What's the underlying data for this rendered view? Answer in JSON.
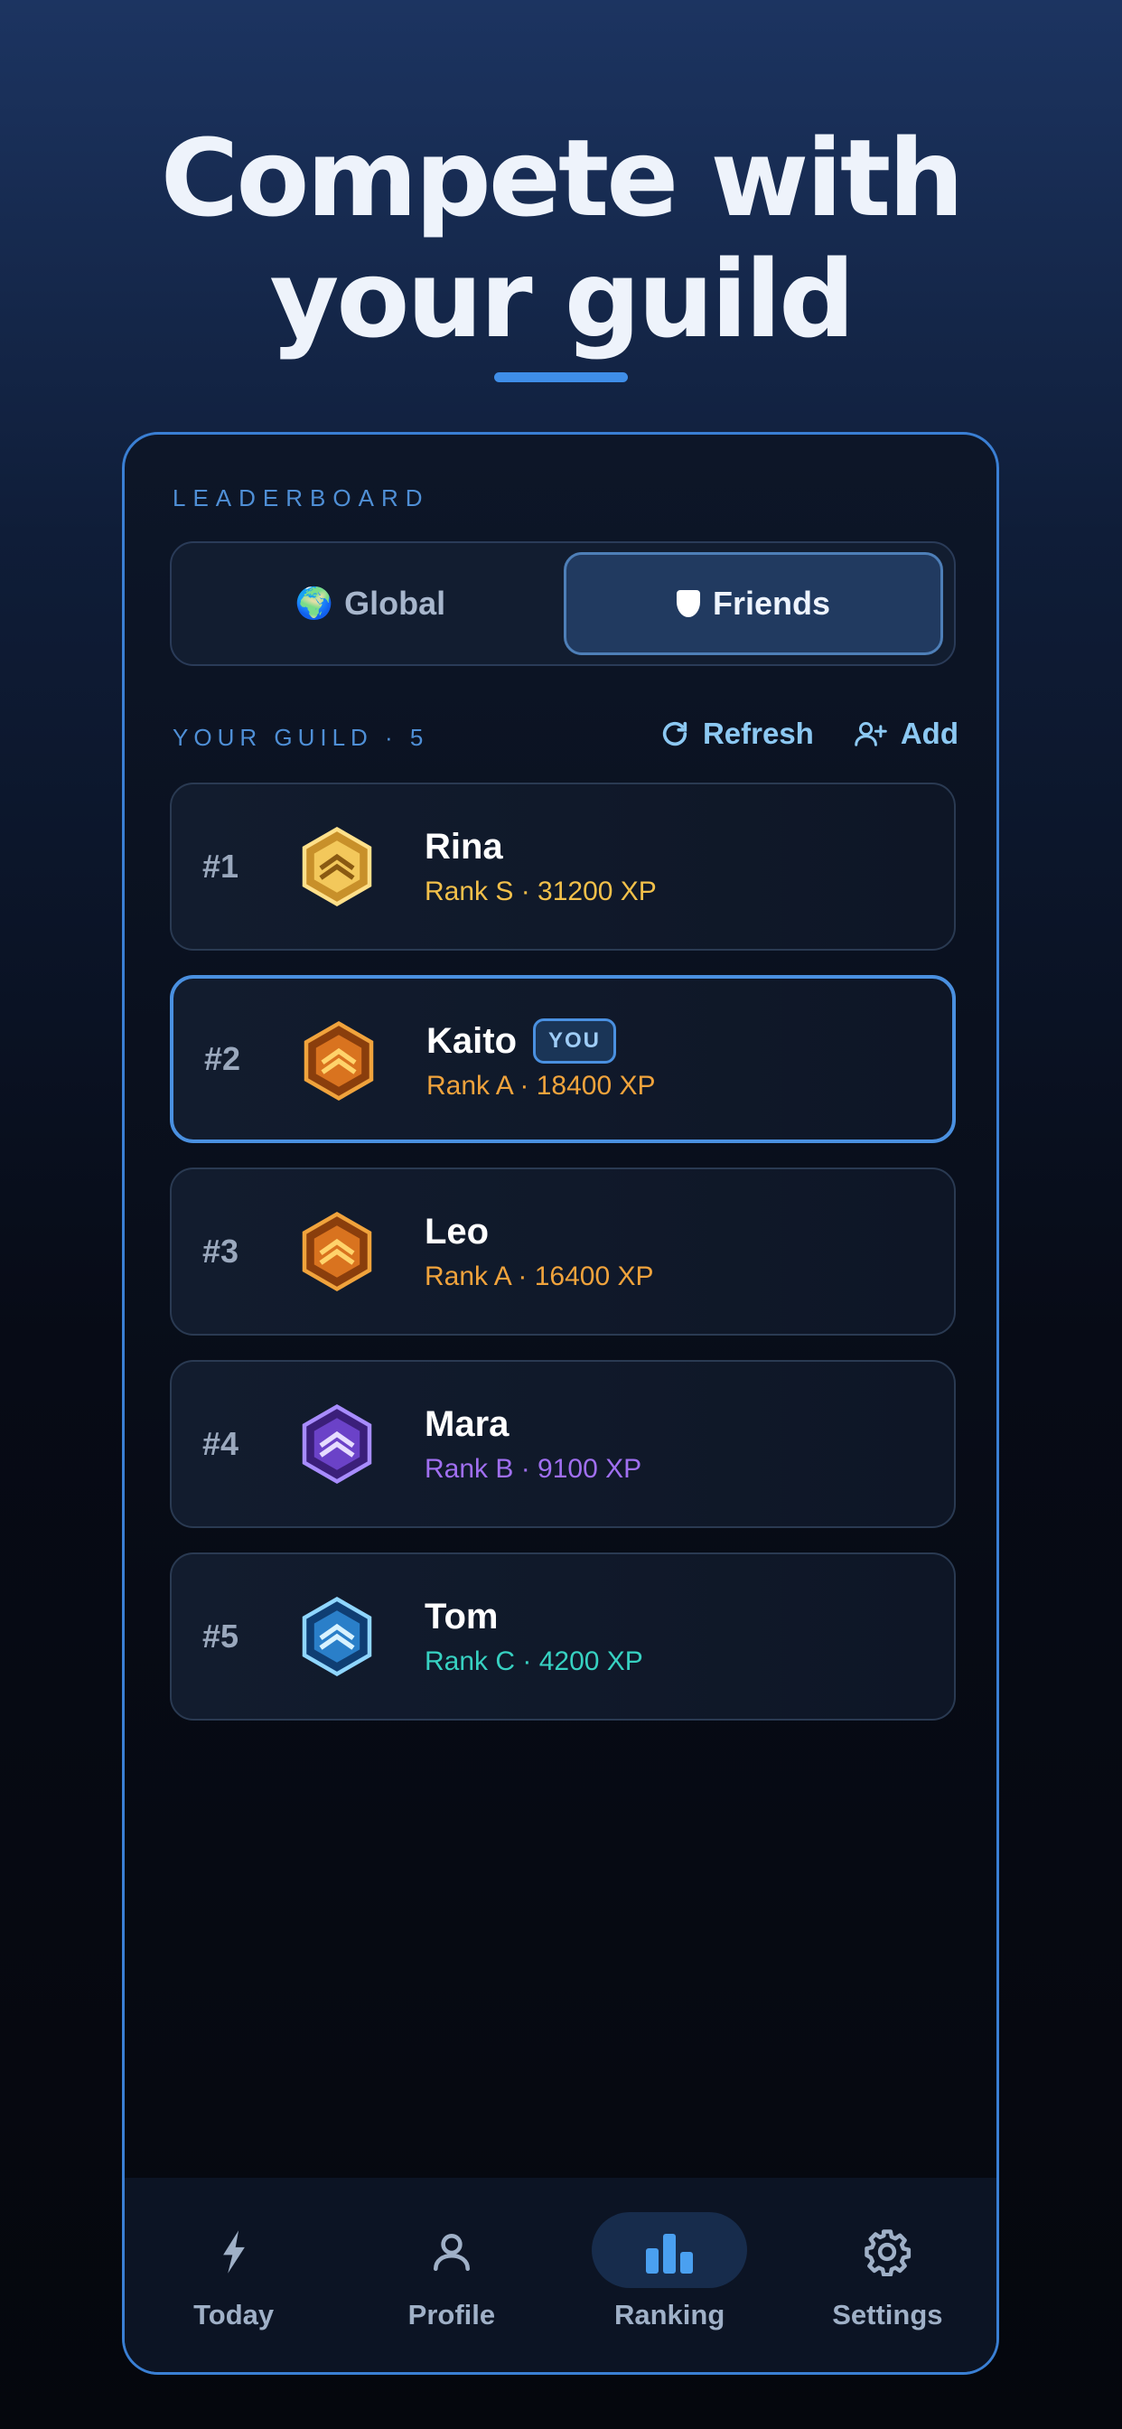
{
  "hero": {
    "line1": "Compete with",
    "line2": "your guild"
  },
  "leaderboard": {
    "label": "LEADERBOARD",
    "tabs": [
      {
        "label": "Global",
        "icon": "globe-icon",
        "emoji": "🌍",
        "selected": false
      },
      {
        "label": "Friends",
        "icon": "shield-icon",
        "selected": true
      }
    ],
    "guild_label": "YOUR GUILD · 5",
    "refresh_label": "Refresh",
    "add_label": "Add",
    "you_tag": "YOU",
    "rows": [
      {
        "rank": "#1",
        "name": "Rina",
        "meta": "Rank S · 31200 XP",
        "color": "#f2c04a",
        "badge": "gold-badge-icon",
        "you": false
      },
      {
        "rank": "#2",
        "name": "Kaito",
        "meta": "Rank A · 18400 XP",
        "color": "#f0a33c",
        "badge": "bronze-badge-icon",
        "you": true
      },
      {
        "rank": "#3",
        "name": "Leo",
        "meta": "Rank A · 16400 XP",
        "color": "#f0a33c",
        "badge": "bronze-badge-icon",
        "you": false
      },
      {
        "rank": "#4",
        "name": "Mara",
        "meta": "Rank B · 9100 XP",
        "color": "#a06ff0",
        "badge": "purple-badge-icon",
        "you": false
      },
      {
        "rank": "#5",
        "name": "Tom",
        "meta": "Rank C · 4200 XP",
        "color": "#37d2c2",
        "badge": "blue-badge-icon",
        "you": false
      }
    ]
  },
  "nav": [
    {
      "label": "Today",
      "icon": "lightning-icon",
      "active": false
    },
    {
      "label": "Profile",
      "icon": "person-icon",
      "active": false
    },
    {
      "label": "Ranking",
      "icon": "bar-chart-icon",
      "active": true
    },
    {
      "label": "Settings",
      "icon": "gear-icon",
      "active": false
    }
  ],
  "colors": {
    "accent": "#3f8ee8",
    "gold": "#f2c04a",
    "bronze": "#f0a33c",
    "purple": "#a06ff0",
    "teal": "#37d2c2"
  }
}
